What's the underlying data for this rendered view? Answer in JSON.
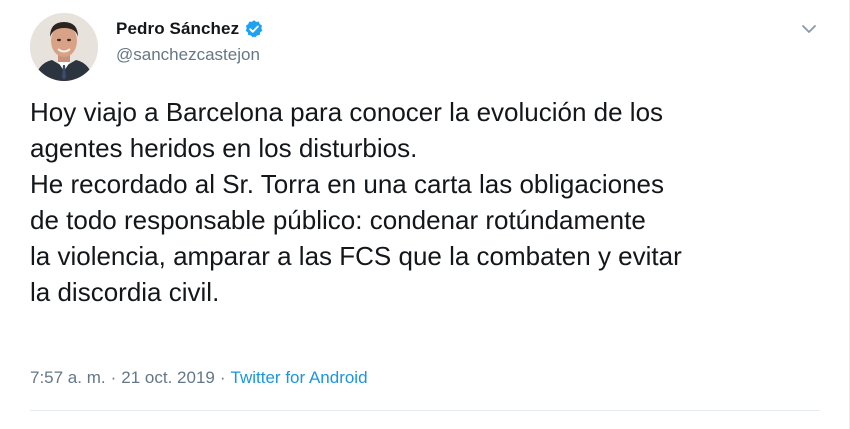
{
  "author": {
    "display_name": "Pedro Sánchez",
    "handle": "@sanchezcastejon",
    "verified": true
  },
  "tweet": {
    "lines": [
      "Hoy viajo a Barcelona para conocer la evolución de los",
      "agentes heridos en los disturbios.",
      "He recordado al Sr. Torra en una carta las obligaciones",
      "de todo responsable público: condenar rotúndamente",
      "la violencia, amparar a las FCS que la combaten y evitar",
      "la discordia civil."
    ]
  },
  "meta": {
    "time": "7:57 a. m.",
    "separator": "·",
    "date": "21 oct. 2019",
    "source": "Twitter for Android"
  },
  "colors": {
    "text": "#14171a",
    "secondary": "#657786",
    "link": "#1b95e0",
    "verified_badge": "#1da1f2"
  },
  "icons": {
    "verified": "verified-badge-icon",
    "menu": "chevron-down-icon"
  }
}
